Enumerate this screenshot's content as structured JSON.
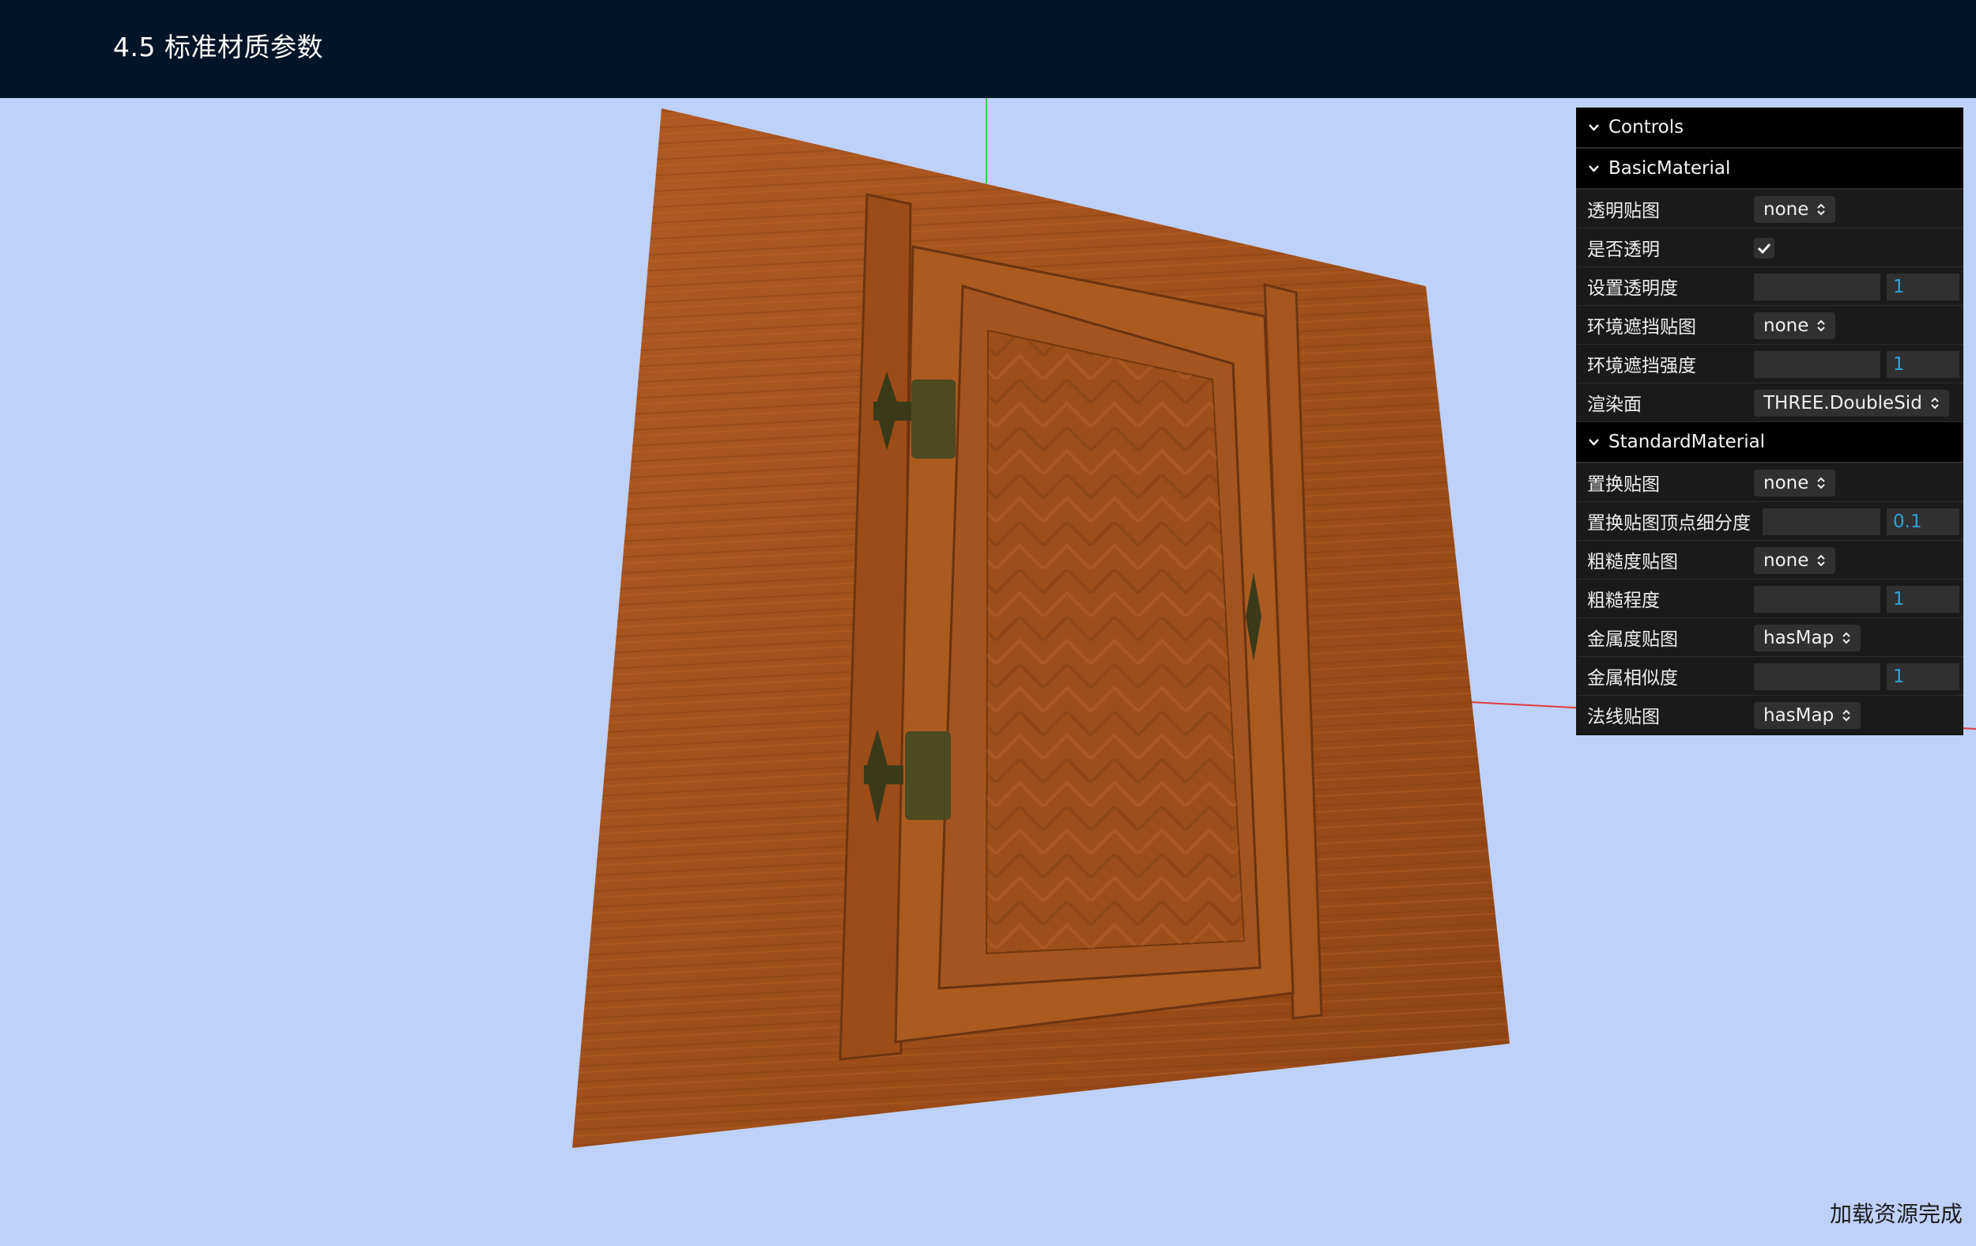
{
  "header": {
    "title": "4.5 标准材质参数"
  },
  "status": {
    "text": "加载资源完成"
  },
  "gui": {
    "root_title": "Controls",
    "basic": {
      "title": "BasicMaterial",
      "alpha_map": {
        "label": "透明贴图",
        "value": "none"
      },
      "transparent": {
        "label": "是否透明",
        "checked": true
      },
      "opacity": {
        "label": "设置透明度",
        "value": "1",
        "fraction": 1.0
      },
      "ao_map": {
        "label": "环境遮挡贴图",
        "value": "none"
      },
      "ao_intensity": {
        "label": "环境遮挡强度",
        "value": "1",
        "fraction": 1.0
      },
      "side": {
        "label": "渲染面",
        "value": "THREE.DoubleSid"
      }
    },
    "standard": {
      "title": "StandardMaterial",
      "displacement_map": {
        "label": "置换贴图",
        "value": "none"
      },
      "displacement_scale": {
        "label": "置换贴图顶点细分度",
        "value": "0.1",
        "fraction": 1.0
      },
      "roughness_map": {
        "label": "粗糙度贴图",
        "value": "none"
      },
      "roughness": {
        "label": "粗糙程度",
        "value": "1",
        "fraction": 1.0
      },
      "metalness_map": {
        "label": "金属度贴图",
        "value": "hasMap"
      },
      "metalness": {
        "label": "金属相似度",
        "value": "1",
        "fraction": 1.0
      },
      "normal_map": {
        "label": "法线贴图",
        "value": "hasMap"
      }
    }
  },
  "colors": {
    "header_bg": "#021428",
    "viewport_bg": "#bed1fa",
    "wood": "#a4521b",
    "gui_accent": "#2fa1d6",
    "axis_green": "#2fd14a",
    "axis_red": "#e03c3c"
  }
}
